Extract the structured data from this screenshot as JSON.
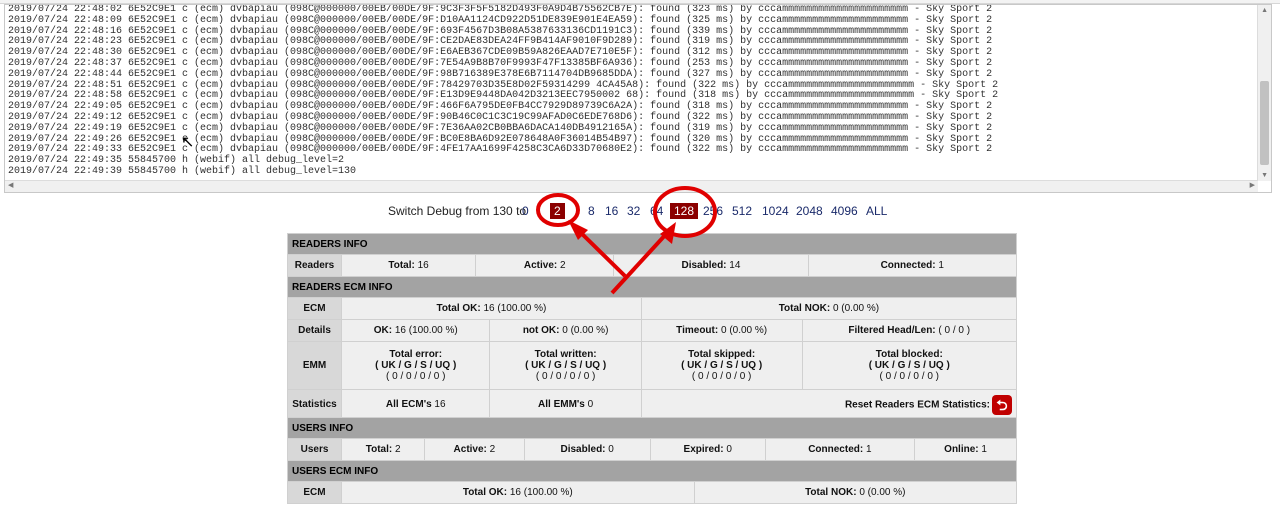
{
  "log": {
    "lines": [
      "2019/07/24 22:48:02 6E52C9E1 c (ecm) dvbapiau (098C@000000/00EB/00DE/9F:9C3F3F5F5182D493F0A9D4B75562CB7E): found (323 ms) by cccammmmmmmmmmmmmmmmmmmmm - Sky Sport 2",
      "2019/07/24 22:48:09 6E52C9E1 c (ecm) dvbapiau (098C@000000/00EB/00DE/9F:D10AA1124CD922D51DE839E901E4EA59): found (325 ms) by cccammmmmmmmmmmmmmmmmmmmm - Sky Sport 2",
      "2019/07/24 22:48:16 6E52C9E1 c (ecm) dvbapiau (098C@000000/00EB/00DE/9F:693F4567D3B08A5387633136CD1191C3): found (339 ms) by cccammmmmmmmmmmmmmmmmmmmm - Sky Sport 2",
      "2019/07/24 22:48:23 6E52C9E1 c (ecm) dvbapiau (098C@000000/00EB/00DE/9F:CE2DAE83DEA24FF9B414AF9010F9D289): found (319 ms) by cccammmmmmmmmmmmmmmmmmmmm - Sky Sport 2",
      "2019/07/24 22:48:30 6E52C9E1 c (ecm) dvbapiau (098C@000000/00EB/00DE/9F:E6AEB367CDE09B59A826EAAD7E710E5F): found (312 ms) by cccammmmmmmmmmmmmmmmmmmmm - Sky Sport 2",
      "2019/07/24 22:48:37 6E52C9E1 c (ecm) dvbapiau (098C@000000/00EB/00DE/9F:7E54A9B8B70F9993F47F13385BF6A936): found (253 ms) by cccammmmmmmmmmmmmmmmmmmmm - Sky Sport 2",
      "2019/07/24 22:48:44 6E52C9E1 c (ecm) dvbapiau (098C@000000/00EB/00DE/9F:98B716389E378E6B7114704DB9685DDA): found (327 ms) by cccammmmmmmmmmmmmmmmmmmmm - Sky Sport 2",
      "2019/07/24 22:48:51 6E52C9E1 c (ecm) dvbapiau (098C@000000/00EB/00DE/9F:78429703D35E8D02F59314299 4CA45A8): found (322 ms) by cccammmmmmmmmmmmmmmmmmmmm - Sky Sport 2",
      "2019/07/24 22:48:58 6E52C9E1 c (ecm) dvbapiau (098C@000000/00EB/00DE/9F:E13D9E9448DA042D3213EEC7950002 68): found (318 ms) by cccammmmmmmmmmmmmmmmmmmmm - Sky Sport 2",
      "2019/07/24 22:49:05 6E52C9E1 c (ecm) dvbapiau (098C@000000/00EB/00DE/9F:466F6A795DE0FB4CC7929D89739C6A2A): found (318 ms) by cccammmmmmmmmmmmmmmmmmmmm - Sky Sport 2",
      "2019/07/24 22:49:12 6E52C9E1 c (ecm) dvbapiau (098C@000000/00EB/00DE/9F:90B46C0C1C3C19C99AFAD0C6EDE768D6): found (322 ms) by cccammmmmmmmmmmmmmmmmmmmm - Sky Sport 2",
      "2019/07/24 22:49:19 6E52C9E1 c (ecm) dvbapiau (098C@000000/00EB/00DE/9F:7E36AA02CB0BBA6DACA140DB4912165A): found (319 ms) by cccammmmmmmmmmmmmmmmmmmmm - Sky Sport 2",
      "2019/07/24 22:49:26 6E52C9E1 c (ecm) dvbapiau (098C@000000/00EB/00DE/9F:BC0E8BA6D92E078648A0F36014B54B97): found (320 ms) by cccammmmmmmmmmmmmmmmmmmmm - Sky Sport 2",
      "2019/07/24 22:49:33 6E52C9E1 c (ecm) dvbapiau (098C@000000/00EB/00DE/9F:4FE17AA1699F4258C3CA6D33D70680E2): found (322 ms) by cccammmmmmmmmmmmmmmmmmmmm - Sky Sport 2",
      "2019/07/24 22:49:35 55845700 h (webif) all debug_level=2",
      "2019/07/24 22:49:39 55845700 h (webif) all debug_level=130"
    ]
  },
  "debug": {
    "label": "Switch Debug from 130 to",
    "options": [
      "0",
      "2",
      "8",
      "16",
      "32",
      "64",
      "128",
      "256",
      "512",
      "1024",
      "2048",
      "4096",
      "ALL"
    ],
    "selected": [
      "2",
      "128"
    ]
  },
  "readers_info": {
    "title": "READERS INFO",
    "row_label": "Readers",
    "total_label": "Total:",
    "total": "16",
    "active_label": "Active:",
    "active": "2",
    "disabled_label": "Disabled:",
    "disabled": "14",
    "connected_label": "Connected:",
    "connected": "1"
  },
  "readers_ecm": {
    "title": "READERS ECM INFO",
    "ecm_label": "ECM",
    "total_ok_label": "Total OK:",
    "total_ok": "16 (100.00 %)",
    "total_nok_label": "Total NOK:",
    "total_nok": "0 (0.00 %)",
    "details_label": "Details",
    "ok_label": "OK:",
    "ok": "16 (100.00 %)",
    "not_ok_label": "not OK:",
    "not_ok": "0 (0.00 %)",
    "timeout_label": "Timeout:",
    "timeout": "0 (0.00 %)",
    "filtered_label": "Filtered Head/Len:",
    "filtered": "( 0 / 0 )",
    "emm_label": "EMM",
    "emm_error_label": "Total error:",
    "emm_error_sub": "( UK / G / S / UQ )",
    "emm_error": "( 0 / 0 / 0 / 0 )",
    "emm_written_label": "Total written:",
    "emm_written_sub": "( UK / G / S / UQ )",
    "emm_written": "( 0 / 0 / 0 / 0 )",
    "emm_skipped_label": "Total skipped:",
    "emm_skipped_sub": "( UK / G / S / UQ )",
    "emm_skipped": "( 0 / 0 / 0 / 0 )",
    "emm_blocked_label": "Total blocked:",
    "emm_blocked_sub": "( UK / G / S / UQ )",
    "emm_blocked": "( 0 / 0 / 0 / 0 )",
    "stats_label": "Statistics",
    "all_ecm_label": "All ECM's",
    "all_ecm": "16",
    "all_emm_label": "All EMM's",
    "all_emm": "0",
    "reset_label": "Reset Readers ECM Statistics:"
  },
  "users_info": {
    "title": "USERS INFO",
    "row_label": "Users",
    "total_label": "Total:",
    "total": "2",
    "active_label": "Active:",
    "active": "2",
    "disabled_label": "Disabled:",
    "disabled": "0",
    "expired_label": "Expired:",
    "expired": "0",
    "connected_label": "Connected:",
    "connected": "1",
    "online_label": "Online:",
    "online": "1"
  },
  "users_ecm": {
    "title": "USERS ECM INFO",
    "ecm_label": "ECM",
    "total_ok_label": "Total OK:",
    "total_ok": "16 (100.00 %)",
    "total_nok_label": "Total NOK:",
    "total_nok": "0 (0.00 %)"
  },
  "annotation": {
    "circle_color": "#e00000",
    "arrow_color": "#e00000"
  }
}
